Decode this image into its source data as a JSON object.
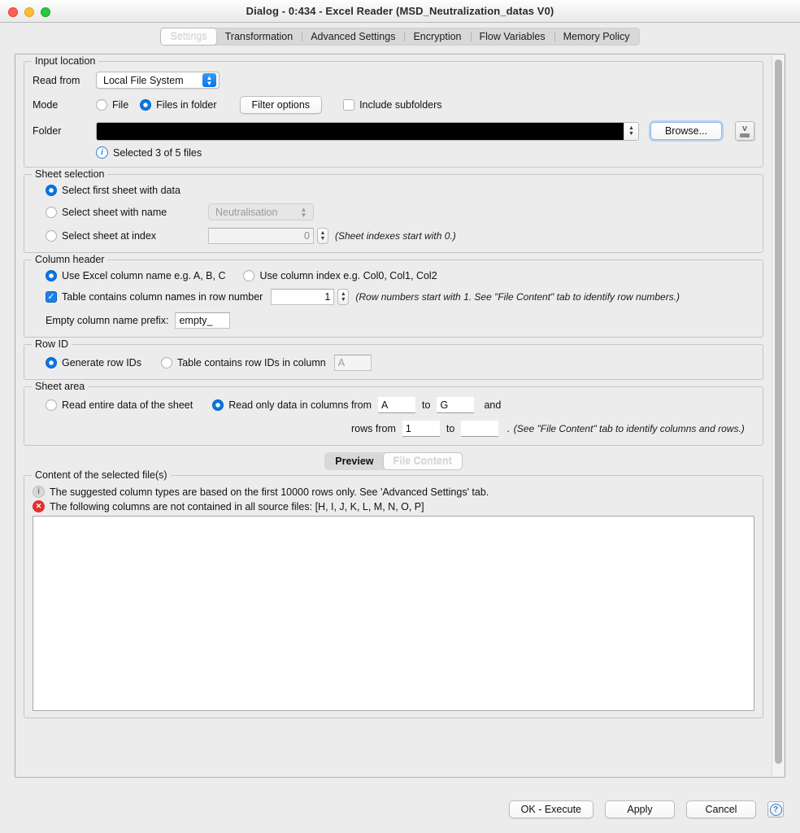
{
  "window": {
    "title": "Dialog - 0:434 - Excel Reader (MSD_Neutralization_datas V0)",
    "traffic_lights": [
      "close",
      "minimize",
      "zoom"
    ]
  },
  "tabs": [
    {
      "label": "Settings",
      "selected": true
    },
    {
      "label": "Transformation",
      "selected": false
    },
    {
      "label": "Advanced Settings",
      "selected": false
    },
    {
      "label": "Encryption",
      "selected": false
    },
    {
      "label": "Flow Variables",
      "selected": false
    },
    {
      "label": "Memory Policy",
      "selected": false
    }
  ],
  "input_location": {
    "legend": "Input location",
    "read_from_label": "Read from",
    "read_from_value": "Local File System",
    "mode_label": "Mode",
    "mode_file": "File",
    "mode_files_in_folder": "Files in folder",
    "filter_options_button": "Filter options",
    "include_subfolders": "Include subfolders",
    "folder_label": "Folder",
    "folder_value": "",
    "browse_button": "Browse...",
    "selected_files_text": "Selected 3 of 5 files"
  },
  "sheet_selection": {
    "legend": "Sheet selection",
    "first_sheet": "Select first sheet with data",
    "sheet_with_name": "Select sheet with name",
    "sheet_name_value": "Neutralisation",
    "sheet_at_index": "Select sheet at index",
    "sheet_index_value": "0",
    "index_hint": "(Sheet indexes start with 0.)"
  },
  "column_header": {
    "legend": "Column header",
    "use_excel_name": "Use Excel column name e.g. A, B, C",
    "use_column_index": "Use column index e.g. Col0, Col1, Col2",
    "table_contains_names": "Table contains column names in row number",
    "row_number_value": "1",
    "row_hint": "(Row numbers start with 1. See \"File Content\" tab to identify row numbers.)",
    "empty_prefix_label": "Empty column name prefix:",
    "empty_prefix_value": "empty_"
  },
  "row_id": {
    "legend": "Row ID",
    "generate_row_ids": "Generate row IDs",
    "table_contains_row_ids": "Table contains row IDs in column",
    "row_id_column_value": "A"
  },
  "sheet_area": {
    "legend": "Sheet area",
    "read_entire": "Read entire data of the sheet",
    "read_only_columns": "Read only data in columns from",
    "col_from": "A",
    "to_label": "to",
    "col_to": "G",
    "and_label": "and",
    "rows_from_label": "rows from",
    "row_from": "1",
    "row_to": "",
    "period": ".",
    "area_hint": "(See \"File Content\" tab to identify columns and rows.)"
  },
  "preview": {
    "tabs": [
      {
        "label": "Preview",
        "selected": false
      },
      {
        "label": "File Content",
        "selected": true
      }
    ],
    "legend": "Content of the selected file(s)",
    "info_message": "The suggested column types are based on the first 10000 rows only. See 'Advanced Settings' tab.",
    "error_message": "The following columns are not contained in all source files: [H, I, J, K, L, M, N, O, P]",
    "body_text": ""
  },
  "footer": {
    "ok_button": "OK - Execute",
    "apply_button": "Apply",
    "cancel_button": "Cancel",
    "help_button": "?"
  },
  "colors": {
    "accent_blue": "#0a76e8",
    "error_red": "#e0322c",
    "window_bg": "#ececec"
  }
}
